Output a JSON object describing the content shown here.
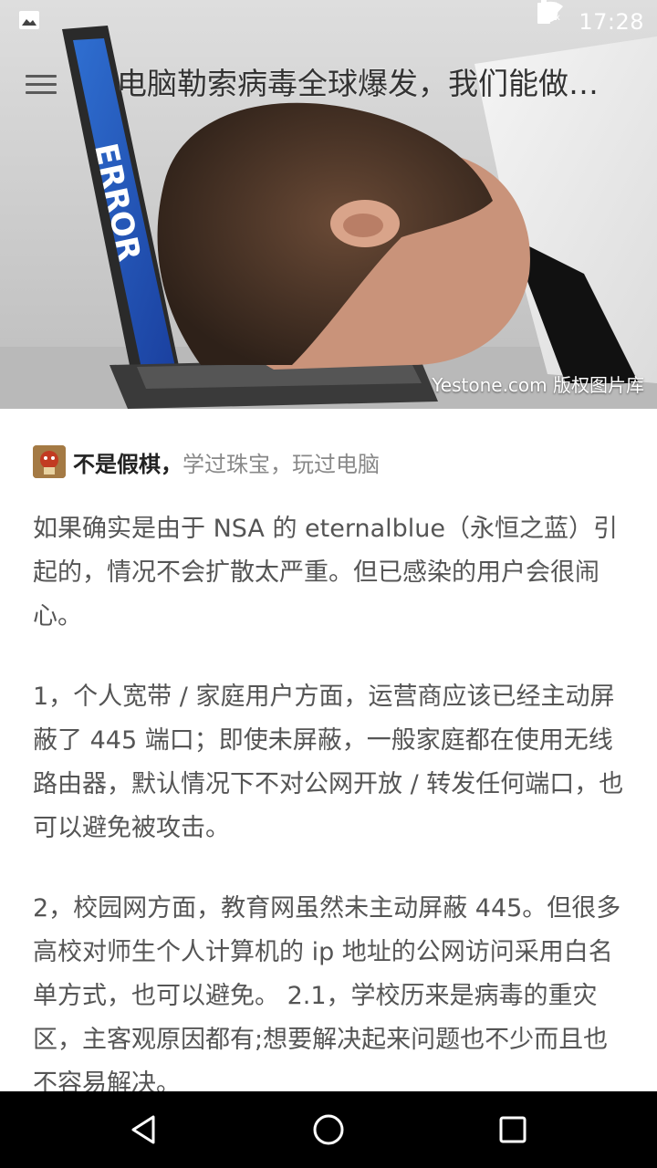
{
  "status_bar": {
    "time": "17:28",
    "icons": [
      "image-notification-icon",
      "alarm-icon",
      "wifi-icon",
      "signal-icon",
      "battery-icon"
    ]
  },
  "app_bar": {
    "title": "电脑勒索病毒全球爆发，我们能做…",
    "menu_icon": "hamburger-menu-icon"
  },
  "hero": {
    "credit": "Yestone.com 版权图片库",
    "screen_text": "ERROR"
  },
  "author": {
    "name": "不是假棋，",
    "bio": "学过珠宝，玩过电脑"
  },
  "article": {
    "paragraphs": [
      "如果确实是由于 NSA 的 eternalblue（永恒之蓝）引起的，情况不会扩散太严重。但已感染的用户会很闹心。",
      "1，个人宽带 / 家庭用户方面，运营商应该已经主动屏蔽了 445 端口；即使未屏蔽，一般家庭都在使用无线路由器，默认情况下不对公网开放 / 转发任何端口，也可以避免被攻击。",
      "2，校园网方面，教育网虽然未主动屏蔽 445。但很多高校对师生个人计算机的 ip 地址的公网访问采用白名单方式，也可以避免。 2.1，学校历来是病毒的重灾区，主客观原因都有;想要解决起来问题也不少而且也不容易解决。"
    ]
  },
  "nav_bar": {
    "icons": [
      "back-icon",
      "home-icon",
      "recents-icon"
    ]
  },
  "colors": {
    "text_primary": "#222222",
    "text_body": "#555555",
    "text_secondary": "#888888",
    "nav_background": "#000000"
  }
}
